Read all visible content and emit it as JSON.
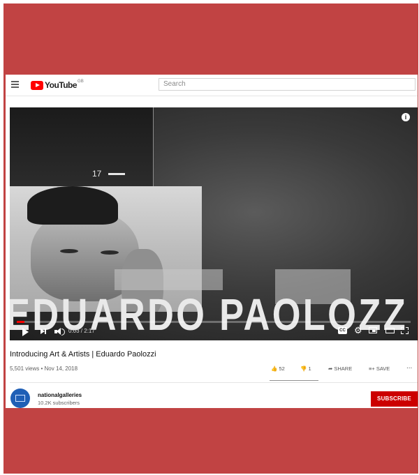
{
  "masthead": {
    "logo_text": "YouTube",
    "region": "GB",
    "search_placeholder": "Search"
  },
  "player": {
    "overlay_title": "EDUARDO PAOLOZZ",
    "frame_number": "17",
    "time_display": "0:03 / 2:17",
    "progress": 0.02,
    "cc_label": "CC"
  },
  "video": {
    "title": "Introducing Art & Artists | Eduardo Paolozzi",
    "stats": "5,501 views • Nov 14, 2018",
    "likes": "52",
    "dislikes": "1",
    "share_label": "SHARE",
    "save_label": "SAVE",
    "more_label": "..."
  },
  "channel": {
    "name": "nationalgalleries",
    "subscribers": "10.2K subscribers",
    "subscribe_label": "SUBSCRIBE"
  },
  "colors": {
    "frame": "#c14343",
    "brand_red": "#ff0000",
    "subscribe": "#cc0000"
  }
}
